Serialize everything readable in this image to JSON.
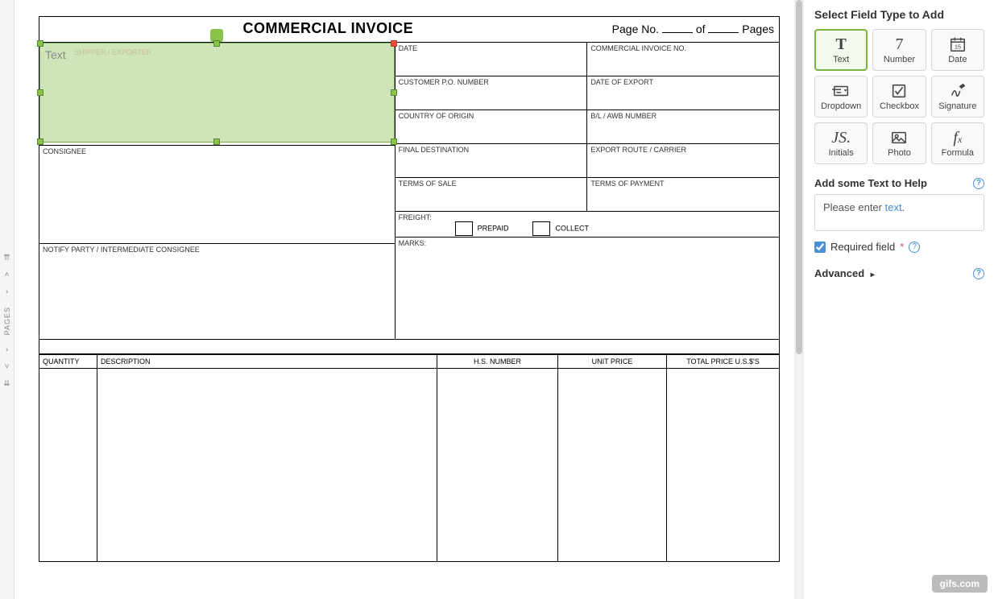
{
  "sidebar": {
    "pages_label": "PAGES"
  },
  "doc": {
    "title": "COMMERCIAL INVOICE",
    "pageinfo": {
      "prefix": "Page No.",
      "of": "of",
      "suffix": "Pages"
    },
    "left_cells": {
      "shipper": "SHIPPER / EXPORTER",
      "consignee": "CONSIGNEE",
      "notify": "NOTIFY PARTY / INTERMEDIATE CONSIGNEE"
    },
    "right_rows": [
      {
        "a": "DATE",
        "b": "COMMERCIAL INVOICE NO."
      },
      {
        "a": "CUSTOMER P.O. NUMBER",
        "b": "DATE OF EXPORT"
      },
      {
        "a": "COUNTRY OF ORIGIN",
        "b": "B/L / AWB NUMBER"
      },
      {
        "a": "FINAL DESTINATION",
        "b": "EXPORT ROUTE / CARRIER"
      },
      {
        "a": "TERMS OF SALE",
        "b": "TERMS OF PAYMENT"
      }
    ],
    "freight": {
      "label": "FREIGHT:",
      "prepaid": "PREPAID",
      "collect": "COLLECT"
    },
    "marks": "MARKS:",
    "items_headers": [
      "QUANTITY",
      "DESCRIPTION",
      "H.S. NUMBER",
      "UNIT PRICE",
      "TOTAL PRICE U.S.$'S"
    ],
    "selected_field": {
      "label": "Text"
    }
  },
  "panel": {
    "title": "Select Field Type to Add",
    "fields": [
      {
        "id": "text",
        "label": "Text",
        "selected": true
      },
      {
        "id": "number",
        "label": "Number"
      },
      {
        "id": "date",
        "label": "Date"
      },
      {
        "id": "dropdown",
        "label": "Dropdown"
      },
      {
        "id": "checkbox",
        "label": "Checkbox"
      },
      {
        "id": "signature",
        "label": "Signature"
      },
      {
        "id": "initials",
        "label": "Initials"
      },
      {
        "id": "photo",
        "label": "Photo"
      },
      {
        "id": "formula",
        "label": "Formula"
      }
    ],
    "help_title": "Add some Text to Help",
    "help_prefix": "Please enter ",
    "help_hint": "text",
    "help_suffix": ".",
    "required_label": "Required field",
    "advanced_label": "Advanced"
  },
  "watermark": "gifs.com"
}
